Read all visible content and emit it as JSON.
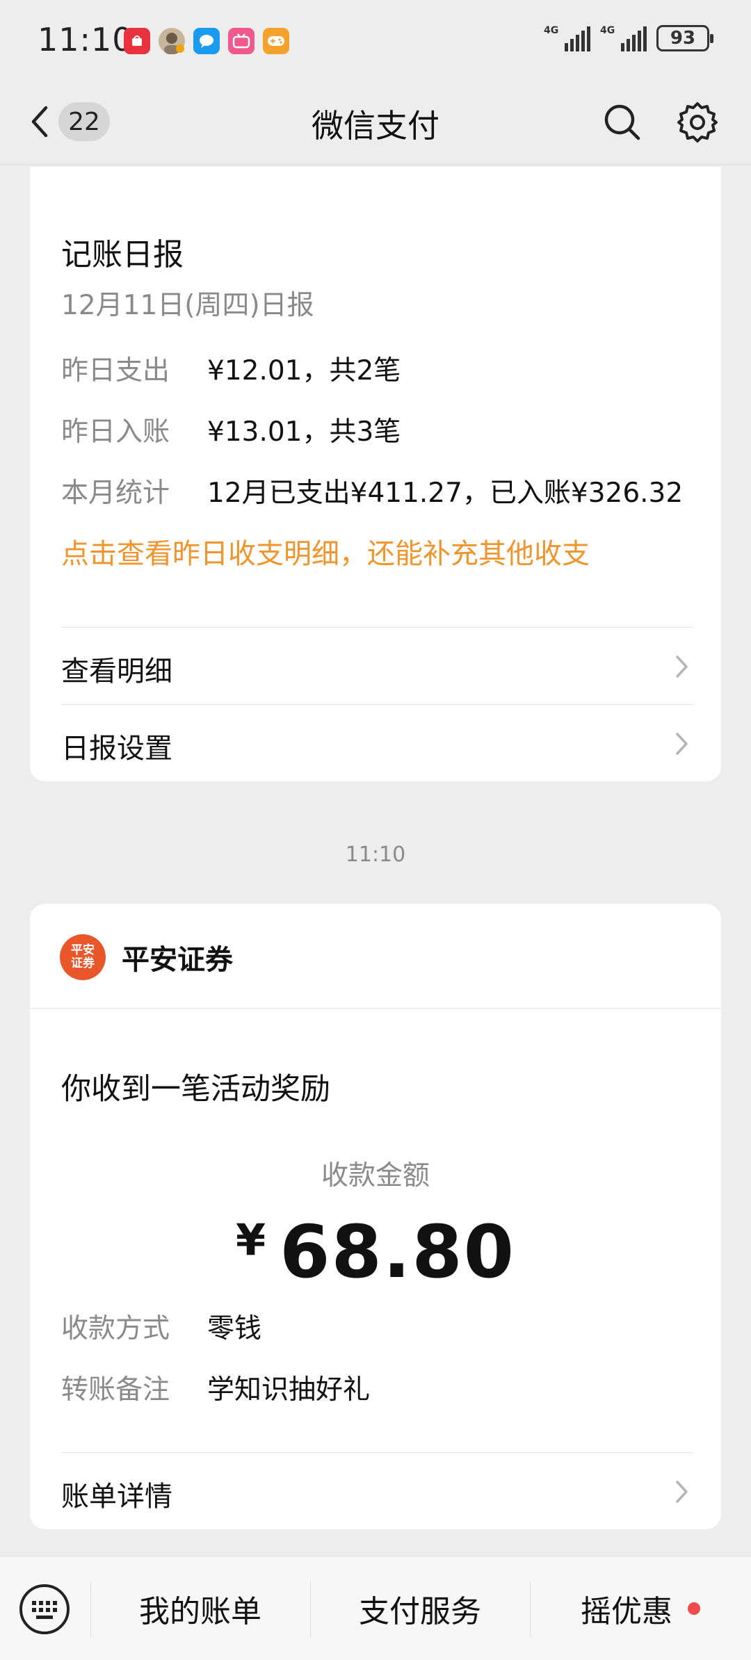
{
  "status_bar": {
    "time": "11:10",
    "app_icons": [
      "huawei-appgallery-icon",
      "avatar-icon",
      "message-icon",
      "bilibili-icon",
      "game-icon"
    ],
    "network_1": "4G",
    "network_2": "4G",
    "battery": "93"
  },
  "nav": {
    "unread_count": "22",
    "title": "微信支付"
  },
  "daily_report": {
    "title": "记账日报",
    "subtitle": "12月11日(周四)日报",
    "rows": [
      {
        "label": "昨日支出",
        "value": "¥12.01，共2笔"
      },
      {
        "label": "昨日入账",
        "value": "¥13.01，共3笔"
      },
      {
        "label": "本月统计",
        "value": "12月已支出¥411.27，已入账¥326.32"
      }
    ],
    "prompt": "点击查看昨日收支明细，还能补充其他收支",
    "links": [
      {
        "label": "查看明细"
      },
      {
        "label": "日报设置"
      }
    ]
  },
  "timestamp": "11:10",
  "reward": {
    "brand_logo_text": "平安证券",
    "brand_name": "平安证券",
    "title": "你收到一笔活动奖励",
    "amount_label": "收款金额",
    "currency": "¥",
    "amount": "68.80",
    "rows": [
      {
        "label": "收款方式",
        "value": "零钱"
      },
      {
        "label": "转账备注",
        "value": "学知识抽好礼"
      }
    ],
    "link": "账单详情"
  },
  "bottom_bar": {
    "tabs": [
      "我的账单",
      "支付服务",
      "摇优惠"
    ]
  },
  "colors": {
    "background": "#ededed",
    "accent_orange": "#f0952d",
    "brand_red": "#e8562a",
    "dot_red": "#f04b4b"
  }
}
